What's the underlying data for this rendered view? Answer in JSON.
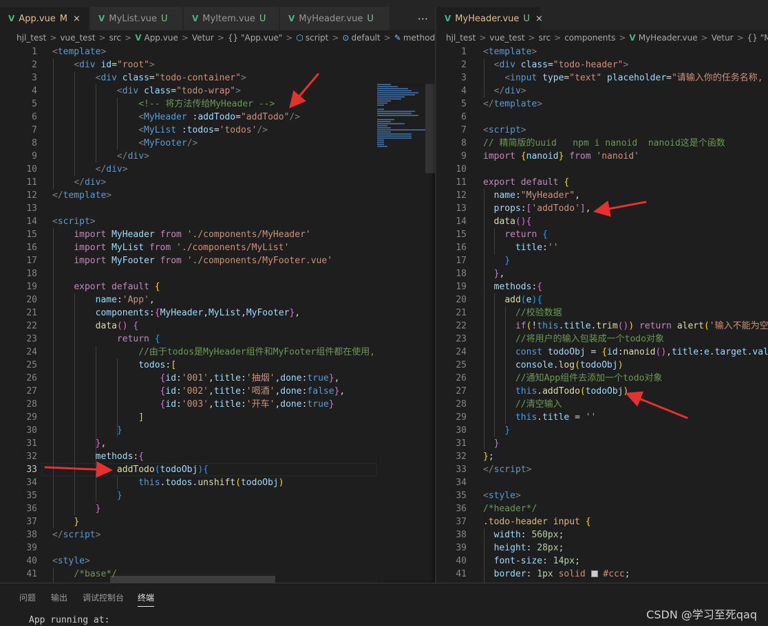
{
  "left": {
    "tabs": [
      {
        "name": "App.vue",
        "status": "M",
        "active": true
      },
      {
        "name": "MyList.vue",
        "status": "U"
      },
      {
        "name": "MyItem.vue",
        "status": "U"
      },
      {
        "name": "MyHeader.vue",
        "status": "U"
      }
    ],
    "more": "···",
    "close": "×",
    "breadcrumb": [
      "hjl_test",
      "vue_test",
      "src",
      "App.vue",
      "Vetur",
      "{} \"App.vue\"",
      "script",
      "default",
      "methods"
    ],
    "current_line": 33
  },
  "right": {
    "tabs": [
      {
        "name": "MyHeader.vue",
        "status": "U",
        "active": true
      }
    ],
    "close": "×",
    "breadcrumb": [
      "hjl_test",
      "vue_test",
      "src",
      "components",
      "MyHeader.vue",
      "Vetur",
      "{} \"MyHea"
    ]
  },
  "panel": {
    "tabs": [
      "问题",
      "输出",
      "调试控制台",
      "终端"
    ],
    "active_tab": "终端",
    "terminal_text": "App running at:"
  },
  "watermark": "CSDN @学习至死qaq",
  "colors": {
    "editor_bg": "#1e1e1e",
    "tab_bg": "#252526",
    "vue_icon": "#41b883",
    "modified": "#e2c08d",
    "untracked": "#73c991",
    "annotation_arrow": "#e8312f"
  }
}
